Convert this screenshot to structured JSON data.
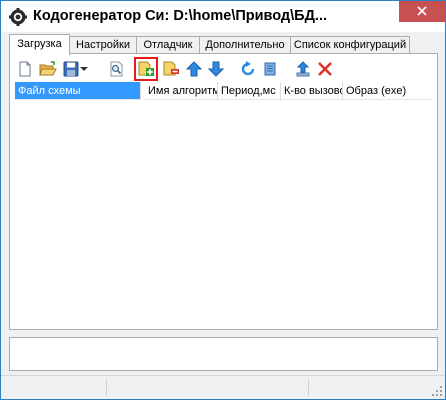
{
  "window": {
    "title": "Кодогенератор Си: D:\\home\\Привод\\БД..."
  },
  "tabs": [
    {
      "label": "Загрузка",
      "active": true
    },
    {
      "label": "Настройки",
      "active": false
    },
    {
      "label": "Отладчик",
      "active": false
    },
    {
      "label": "Дополнительно",
      "active": false
    },
    {
      "label": "Список конфигураций",
      "active": false
    }
  ],
  "toolbar": {
    "buttons": [
      {
        "name": "new-file",
        "icon": "blank-page-icon"
      },
      {
        "name": "open-folder",
        "icon": "open-folder-icon"
      },
      {
        "name": "save",
        "icon": "floppy-disk-icon"
      },
      {
        "name": "save-dropdown",
        "icon": "dropdown-arrow-icon"
      },
      {
        "name": "find",
        "icon": "magnifier-page-icon"
      },
      {
        "name": "add-scheme",
        "icon": "add-file-icon",
        "highlighted": true
      },
      {
        "name": "remove-scheme",
        "icon": "remove-file-icon"
      },
      {
        "name": "move-up",
        "icon": "arrow-up-icon"
      },
      {
        "name": "move-down",
        "icon": "arrow-down-icon"
      },
      {
        "name": "refresh",
        "icon": "refresh-icon"
      },
      {
        "name": "script",
        "icon": "scroll-icon"
      },
      {
        "name": "export",
        "icon": "upload-icon"
      },
      {
        "name": "delete",
        "icon": "red-cross-icon"
      }
    ]
  },
  "list": {
    "columns": [
      {
        "label": "Файл схемы",
        "selected": true
      },
      {
        "label": "Имя алгоритма",
        "selected": false
      },
      {
        "label": "Период,мс",
        "selected": false
      },
      {
        "label": "К-во вызовов",
        "selected": false
      },
      {
        "label": "Образ (exe)",
        "selected": false
      }
    ]
  },
  "colors": {
    "accent": "#3399ff",
    "close": "#c75050",
    "highlight_border": "#e81b1b"
  }
}
